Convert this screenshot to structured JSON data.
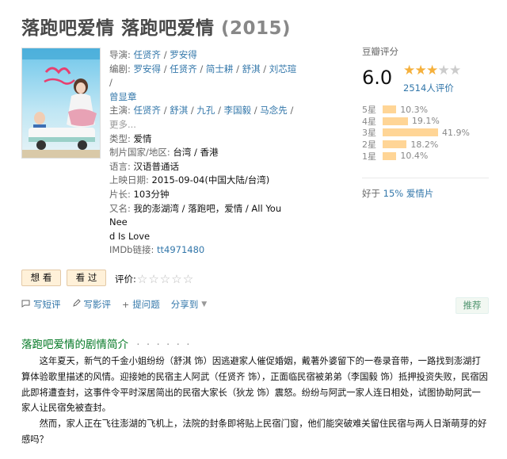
{
  "title": {
    "main": "落跑吧爱情 落跑吧爱情",
    "year": "(2015)"
  },
  "info": {
    "director_label": "导演:",
    "directors": [
      "任贤齐",
      "罗安得"
    ],
    "writer_label": "编剧:",
    "writers": [
      "罗安得",
      "任贤齐",
      "简士耕",
      "舒淇",
      "刘芯瑄",
      "曾显章"
    ],
    "cast_label": "主演:",
    "cast": [
      "任贤齐",
      "舒淇",
      "九孔",
      "李国毅",
      "马念先"
    ],
    "cast_more": "更多...",
    "genre_label": "类型:",
    "genre": "爱情",
    "country_label": "制片国家/地区:",
    "country": "台湾 / 香港",
    "language_label": "语言:",
    "language": "汉语普通话",
    "release_label": "上映日期:",
    "release": "2015-09-04(中国大陆/台湾)",
    "runtime_label": "片长:",
    "runtime": "103分钟",
    "aka_label": "又名:",
    "aka_line1": "我的澎湖湾 / 落跑吧，爱情 / All You Nee",
    "aka_line2": "d Is Love",
    "imdb_label": "IMDb链接:",
    "imdb": "tt4971480"
  },
  "rating": {
    "label": "豆瓣评分",
    "score": "6.0",
    "stars_on": 3,
    "stars_total": 5,
    "votes": "2514人评价",
    "breakdown": [
      {
        "label": "5星",
        "pct": "10.3%",
        "value": 10.3
      },
      {
        "label": "4星",
        "pct": "19.1%",
        "value": 19.1
      },
      {
        "label": "3星",
        "pct": "41.9%",
        "value": 41.9
      },
      {
        "label": "2星",
        "pct": "18.2%",
        "value": 18.2
      },
      {
        "label": "1星",
        "pct": "10.4%",
        "value": 10.4
      }
    ],
    "better_prefix": "好于",
    "better_link": "15% 爱情片"
  },
  "buttons": {
    "want": "想 看",
    "seen": "看 过",
    "rate_label": "评价:"
  },
  "actions": {
    "short_review": "写短评",
    "review": "写影评",
    "ask": "提问题",
    "share": "分享到",
    "recommend": "推荐"
  },
  "summary": {
    "title": "落跑吧爱情的剧情简介",
    "dots": "· · · · · ·",
    "p1": "这年夏天，新气的千金小姐纷纷（舒淇 饰）因逃避家人催促婚姻，戴著外婆留下的一卷录音带，一路找到澎湖打算体验歌里描述的风情。迎接她的民宿主人阿武（任贤齐 饰），正面临民宿被弟弟（李国毅 饰）抵押投资失败，民宿因此即将遭查封，这事件令平时深居简出的民宿大家长（狄龙 饰）震怒。纷纷与阿武一家人连日相处，试图协助阿武一家人让民宿免被查封。",
    "p2": "然而，家人正在飞往澎湖的飞机上，法院的封条即将贴上民宿门窗，他们能突破难关留住民宿与两人日渐萌芽的好感吗？"
  },
  "colors": {
    "link": "#3377aa",
    "star": "#f5b03c",
    "bar": "#ffd596",
    "section_title": "#007722"
  }
}
